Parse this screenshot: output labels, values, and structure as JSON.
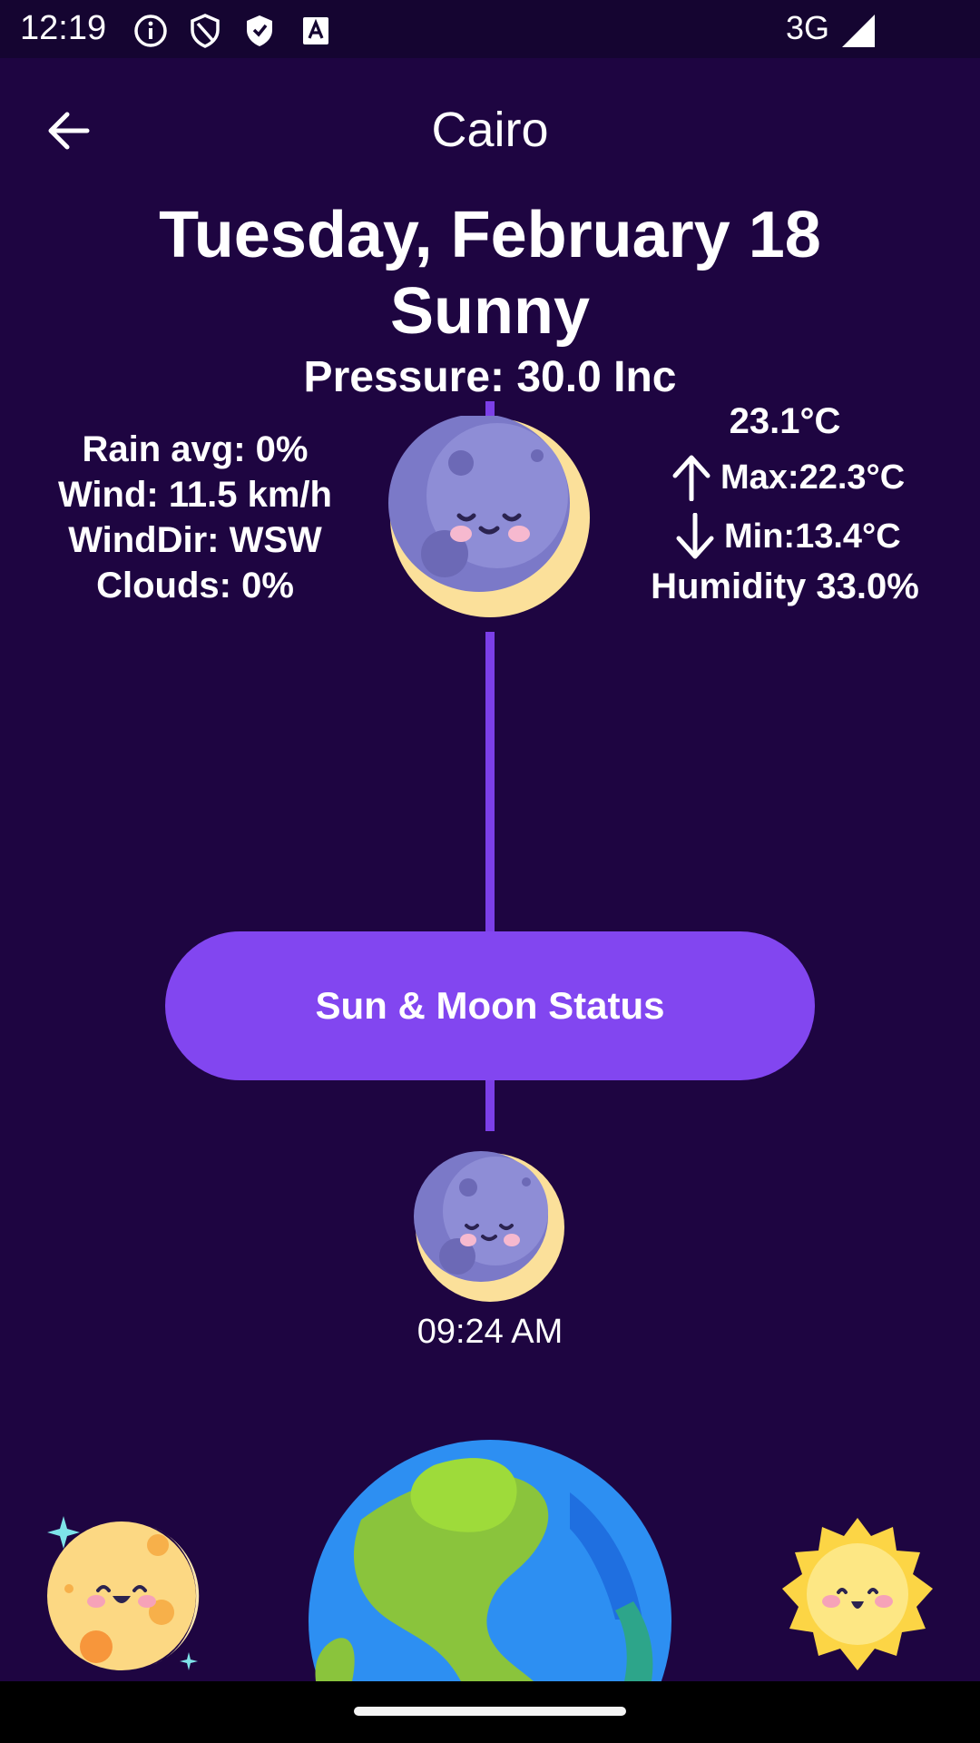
{
  "status_bar": {
    "time": "12:19",
    "network": "3G",
    "icons": [
      "info-icon",
      "shield-icon",
      "shield-check-icon",
      "font-icon",
      "signal-icon"
    ]
  },
  "header": {
    "city": "Cairo",
    "back_icon": "arrow-left-icon"
  },
  "weather": {
    "date": "Tuesday, February 18",
    "condition": "Sunny",
    "pressure": "Pressure: 30.0 Inc",
    "rain": "Rain avg: 0%",
    "wind": "Wind: 11.5 km/h",
    "wind_dir": "WindDir: WSW",
    "clouds": "Clouds: 0%",
    "temp": "23.1°C",
    "max": "Max:22.3°C",
    "min": "Min:13.4°C",
    "humidity": "Humidity 33.0%"
  },
  "button": {
    "label": "Sun & Moon Status"
  },
  "moon_event": {
    "time": "09:24 AM"
  },
  "colors": {
    "background": "#1e0541",
    "status_bar": "#150531",
    "accent": "#8246f0",
    "line": "#7c3fe8"
  }
}
